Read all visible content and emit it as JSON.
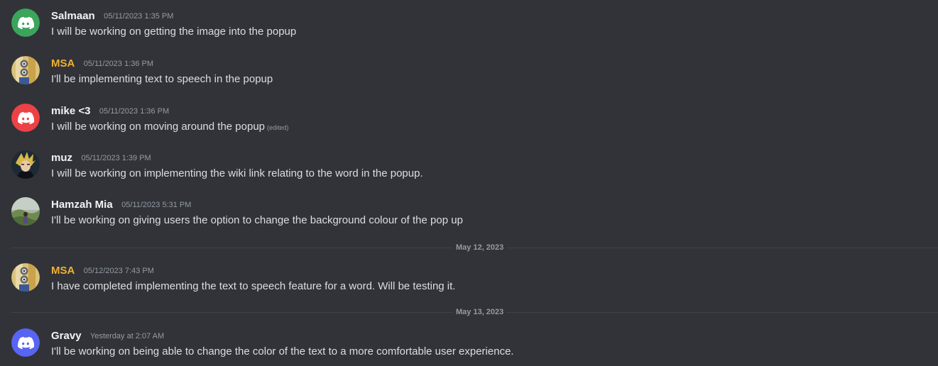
{
  "messages": [
    {
      "username": "Salmaan",
      "username_color": "#f2f3f5",
      "timestamp": "05/11/2023 1:35 PM",
      "text": "I will be working on getting the image into the popup",
      "avatar": "discord-default-green-icon"
    },
    {
      "username": "MSA",
      "username_color": "#f0b132",
      "timestamp": "05/11/2023 1:36 PM",
      "text": "I'll be implementing text to speech in the popup",
      "avatar": "minion-avatar"
    },
    {
      "username": "mike <3",
      "username_color": "#f2f3f5",
      "timestamp": "05/11/2023 1:36 PM",
      "text": "I will be working on moving around the popup",
      "edited": "(edited)",
      "avatar": "discord-default-red-icon"
    },
    {
      "username": "muz",
      "username_color": "#f2f3f5",
      "timestamp": "05/11/2023 1:39 PM",
      "text": "I will be working on implementing the wiki link relating to the word in the popup.",
      "avatar": "anime-character-avatar"
    },
    {
      "username": "Hamzah Mia",
      "username_color": "#f2f3f5",
      "timestamp": "05/11/2023 5:31 PM",
      "text": "I'll be working on giving users the option to change the background colour of the pop up",
      "avatar": "landscape-photo-avatar"
    },
    {
      "username": "MSA",
      "username_color": "#f0b132",
      "timestamp": "05/12/2023 7:43 PM",
      "text": "I have completed implementing the text to speech feature for a word. Will be testing it.",
      "avatar": "minion-avatar"
    },
    {
      "username": "Gravy",
      "username_color": "#f2f3f5",
      "timestamp": "Yesterday at 2:07 AM",
      "text": "I'll be working on being able to change the color of the text to a more comfortable user experience.",
      "avatar": "discord-default-blurple-icon"
    }
  ],
  "dividers": [
    {
      "label": "May 12, 2023"
    },
    {
      "label": "May 13, 2023"
    }
  ],
  "colors": {
    "background": "#313338",
    "green_avatar": "#3ba55c",
    "red_avatar": "#ed4245",
    "blurple_avatar": "#5865f2",
    "msa_name": "#f0b132"
  }
}
